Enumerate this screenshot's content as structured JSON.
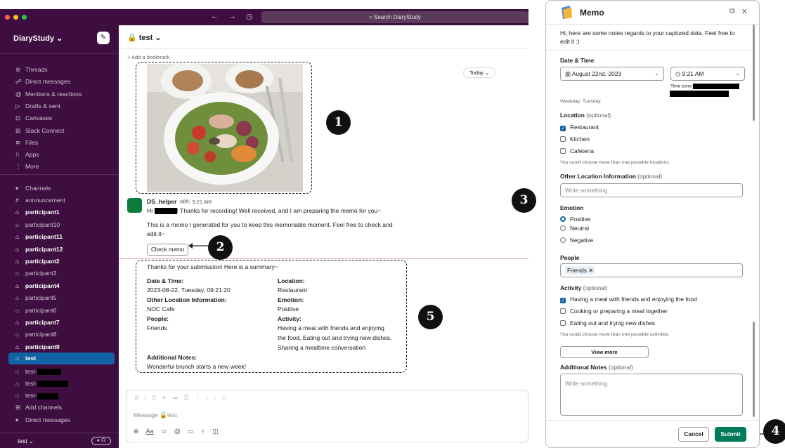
{
  "search_placeholder": "Search DiaryStudy",
  "workspace": "DiaryStudy ⌄",
  "sidebar_nav": [
    {
      "icon": "⊜",
      "label": "Threads"
    },
    {
      "icon": "☍",
      "label": "Direct messages"
    },
    {
      "icon": "@",
      "label": "Mentions & reactions"
    },
    {
      "icon": "▷",
      "label": "Drafts & sent"
    },
    {
      "icon": "⊡",
      "label": "Canvases"
    },
    {
      "icon": "⊞",
      "label": "Slack Connect"
    },
    {
      "icon": "≋",
      "label": "Files"
    },
    {
      "icon": "⁝⁝",
      "label": "Apps"
    },
    {
      "icon": "⋮",
      "label": "More"
    }
  ],
  "channels_header": "Channels",
  "channels": [
    {
      "label": "announcement",
      "prefix": "#",
      "bold": false
    },
    {
      "label": "participant1",
      "prefix": "🔒",
      "bold": true
    },
    {
      "label": "participant10",
      "prefix": "🔒",
      "bold": false
    },
    {
      "label": "participant11",
      "prefix": "🔒",
      "bold": true
    },
    {
      "label": "participant12",
      "prefix": "🔒",
      "bold": true
    },
    {
      "label": "participant2",
      "prefix": "🔒",
      "bold": true
    },
    {
      "label": "participant3",
      "prefix": "🔒",
      "bold": false
    },
    {
      "label": "participant4",
      "prefix": "🔒",
      "bold": true
    },
    {
      "label": "participant5",
      "prefix": "🔒",
      "bold": false
    },
    {
      "label": "participant6",
      "prefix": "🔒",
      "bold": false
    },
    {
      "label": "participant7",
      "prefix": "🔒",
      "bold": true
    },
    {
      "label": "participant8",
      "prefix": "🔒",
      "bold": false
    },
    {
      "label": "participant9",
      "prefix": "🔒",
      "bold": true
    },
    {
      "label": "test",
      "prefix": "🔒",
      "bold": true,
      "active": true
    },
    {
      "label": "test-",
      "prefix": "🔒",
      "bold": false,
      "redact": 34
    },
    {
      "label": "test-",
      "prefix": "🔒",
      "bold": false,
      "redact": 44
    },
    {
      "label": "test-",
      "prefix": "🔒",
      "bold": false,
      "redact": 30
    }
  ],
  "add_channels": "Add channels",
  "direct_messages_header": "Direct messages",
  "footer_workspace": "test ⌄",
  "channel": {
    "title": "test ⌄",
    "add_bookmark": "+ Add a bookmark",
    "today": "Today ⌄"
  },
  "message": {
    "sender": "DS_helper",
    "app_badge": "APP",
    "time": "9:21 AM",
    "line1_a": "Hi",
    "line1_b": "! Thanks for recording! Well received, and I am preparing the memo for you~",
    "line2": "This is a memo I generated for you to keep this memoriable moment. Feel free to check and",
    "line3": "edit it~",
    "check_memo": "Check memo"
  },
  "summary": {
    "intro": "Thanks for your submission! Here is a summary~",
    "date_label": "Date & Time:",
    "date_value": "2023-08-22, Tuesday, 09:21:20",
    "other_loc_label": "Other Location Information:",
    "other_loc_value": "NOC Cafe",
    "people_label": "People:",
    "people_value": "Friends",
    "notes_label": "Additional Notes:",
    "notes_value": "Wonderful brunch starts a new week!",
    "location_label": "Location:",
    "location_value": "Restaurant",
    "emotion_label": "Emotion:",
    "emotion_value": "Positive",
    "activity_label": "Activity:",
    "activity_lines": [
      "Having a meal with friends and enjoying",
      "the food, Eating out and trying new dishes,",
      "Sharing a mealtime conversation"
    ]
  },
  "composer": {
    "placeholder": "Message 🔒test"
  },
  "badges": [
    "1",
    "2",
    "3",
    "4",
    "5"
  ],
  "memo": {
    "title": "Memo",
    "intro1": "Hi, here are some notes regards to your captured data. Feel free to",
    "intro2": "edit it :)",
    "date_time_label": "Date & Time",
    "date_value": "▥ August 22nd, 2023",
    "time_value": "◷ 9:21 AM",
    "timezone_label": "Time zone:",
    "weekday": "Weekday: Tuesday.",
    "location_label": "Location",
    "optional": "(optional)",
    "locations": [
      {
        "label": "Restaurant",
        "checked": true
      },
      {
        "label": "Kitchen",
        "checked": false
      },
      {
        "label": "Cafeteria",
        "checked": false
      }
    ],
    "location_hint": "You could choose more than one possible locations.",
    "other_loc_label": "Other Location Information",
    "write_something": "Write something",
    "emotion_label": "Emotion",
    "emotions": [
      {
        "label": "Positive",
        "checked": true
      },
      {
        "label": "Neutral",
        "checked": false
      },
      {
        "label": "Negative",
        "checked": false
      }
    ],
    "people_label": "People",
    "people_chip": "Friends ✕",
    "activity_label": "Activity",
    "activities": [
      {
        "label": "Having a meal with friends and enjoying the food",
        "checked": true
      },
      {
        "label": "Cooking or preparing a meal together",
        "checked": false
      },
      {
        "label": "Eating out and trying new dishes",
        "checked": false
      }
    ],
    "activity_hint": "You could choose more than one possible activities.",
    "view_more": "View more",
    "notes_label": "Additional Notes",
    "cancel": "Cancel",
    "submit": "Submit"
  },
  "colors": {
    "sidebar": "#3f0e40",
    "active": "#1164a3",
    "submit": "#007a5a"
  }
}
